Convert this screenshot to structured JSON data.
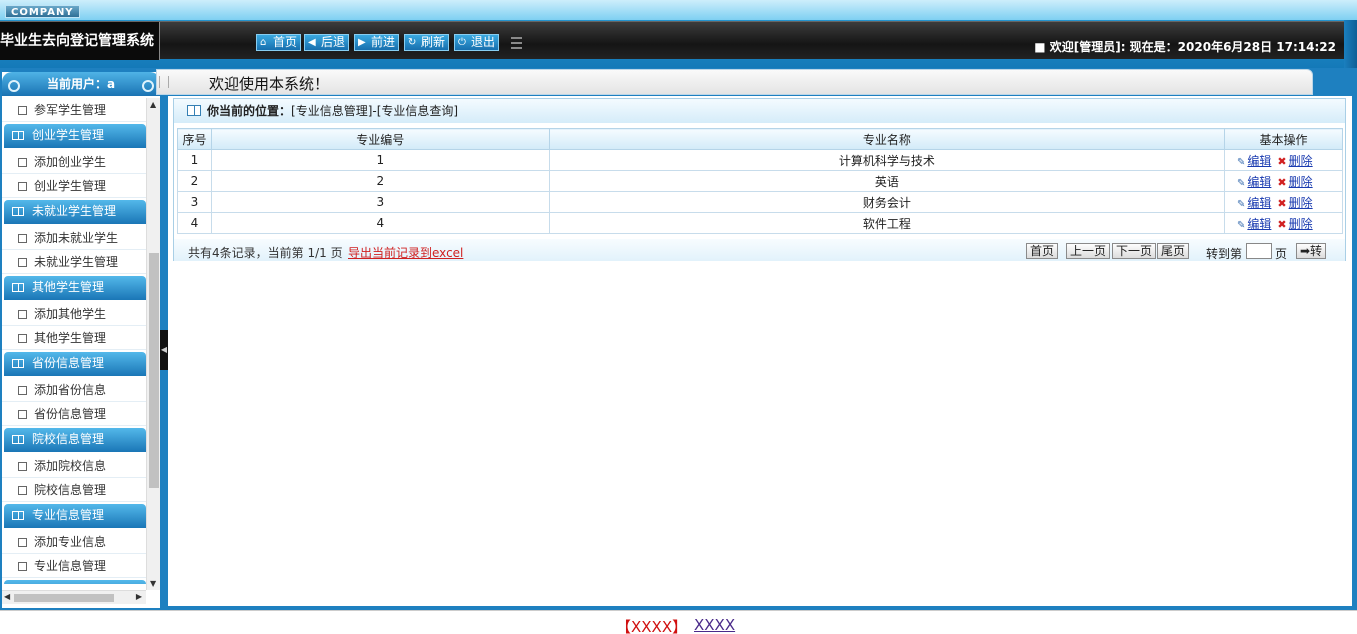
{
  "header": {
    "company": "COMPANY",
    "app_title": "毕业生去向登记管理系统",
    "nav": [
      {
        "label": "首页",
        "icon": "home-icon",
        "glyph": "⌂"
      },
      {
        "label": "后退",
        "icon": "arrow-left-icon",
        "glyph": "◀"
      },
      {
        "label": "前进",
        "icon": "arrow-right-icon",
        "glyph": "▶"
      },
      {
        "label": "刷新",
        "icon": "refresh-icon",
        "glyph": "↻"
      },
      {
        "label": "退出",
        "icon": "power-icon",
        "glyph": "⏻"
      }
    ],
    "welcome": "■ 欢迎[管理员]:  现在是：2020年6月28日 17:14:22"
  },
  "sidebar": {
    "current_user": "当前用户：a",
    "top_item": "参军学生管理",
    "groups": [
      {
        "title": "创业学生管理",
        "items": [
          "添加创业学生",
          "创业学生管理"
        ]
      },
      {
        "title": "未就业学生管理",
        "items": [
          "添加未就业学生",
          "未就业学生管理"
        ]
      },
      {
        "title": "其他学生管理",
        "items": [
          "添加其他学生",
          "其他学生管理"
        ]
      },
      {
        "title": "省份信息管理",
        "items": [
          "添加省份信息",
          "省份信息管理"
        ]
      },
      {
        "title": "院校信息管理",
        "items": [
          "添加院校信息",
          "院校信息管理"
        ]
      },
      {
        "title": "专业信息管理",
        "items": [
          "添加专业信息",
          "专业信息管理"
        ]
      }
    ]
  },
  "main": {
    "welcome": "欢迎使用本系统！",
    "breadcrumb_label": "你当前的位置：",
    "breadcrumb_path": "[专业信息管理]-[专业信息查询]",
    "table": {
      "headers": [
        "序号",
        "专业编号",
        "专业名称",
        "基本操作"
      ],
      "rows": [
        [
          "1",
          "1",
          "计算机科学与技术"
        ],
        [
          "2",
          "2",
          "英语"
        ],
        [
          "3",
          "3",
          "财务会计"
        ],
        [
          "4",
          "4",
          "软件工程"
        ]
      ],
      "edit_label": "编辑",
      "delete_label": "删除"
    },
    "pager": {
      "info": "共有4条记录，当前第 1/1 页",
      "export": "导出当前记录到excel",
      "first": "首页",
      "prev": "上一页",
      "next": "下一页",
      "last": "尾页",
      "goto_label": "转到第",
      "page_label": "页",
      "go": "➡转"
    }
  },
  "footer": {
    "bracket_text": "【XXXX】",
    "link_text": "XXXX"
  }
}
